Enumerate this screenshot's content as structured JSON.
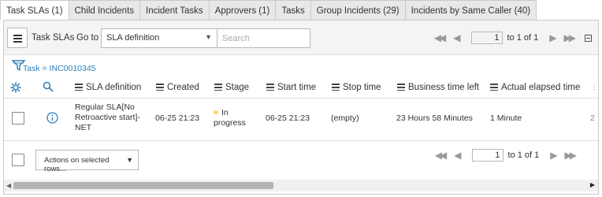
{
  "tabs": [
    {
      "label": "Task SLAs (1)",
      "active": true
    },
    {
      "label": "Child Incidents",
      "active": false
    },
    {
      "label": "Incident Tasks",
      "active": false
    },
    {
      "label": "Approvers (1)",
      "active": false
    },
    {
      "label": "Tasks",
      "active": false
    },
    {
      "label": "Group Incidents (29)",
      "active": false
    },
    {
      "label": "Incidents by Same Caller (40)",
      "active": false
    }
  ],
  "toolbar": {
    "title": "Task SLAs",
    "goto_label": "Go to",
    "goto_selected": "SLA definition",
    "search_placeholder": "Search",
    "page_value": "1",
    "page_range": "to 1 of 1"
  },
  "filter": {
    "text": "Task = INC0010345"
  },
  "columns": [
    "SLA definition",
    "Created",
    "Stage",
    "Start time",
    "Stop time",
    "Business time left",
    "Actual elapsed time"
  ],
  "rows": [
    {
      "sla_definition": "Regular SLA[No Retroactive start]-NET",
      "sla_line1": "Regular SLA[No",
      "sla_line2": "Retroactive start]-",
      "sla_line3": "NET",
      "created": "06-25 21:23",
      "stage_line1": "In",
      "stage_line2": "progress",
      "start_time": "06-25 21:23",
      "stop_time": "(empty)",
      "business_time_left": "23 Hours 58 Minutes",
      "actual_elapsed_time": "1 Minute",
      "cut_off": "2"
    }
  ],
  "footer": {
    "actions_label": "Actions on selected rows...",
    "page_value": "1",
    "page_range": "to 1 of 1"
  },
  "colors": {
    "link": "#2c7fb8",
    "stage_dot": "#f6d76a"
  },
  "scroll": {
    "horizontal_position": 0.0
  }
}
